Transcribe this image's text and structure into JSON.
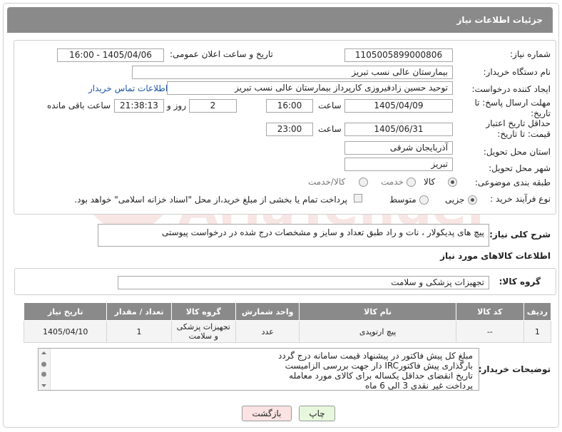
{
  "header": {
    "title": "جزئیات اطلاعات نیاز"
  },
  "form": {
    "need_number_label": "شماره نیاز:",
    "need_number": "1105005899000806",
    "announce_label": "تاریخ و ساعت اعلان عمومی:",
    "announce_value": "1405/04/06 - 16:00",
    "buyer_org_label": "نام دستگاه خریدار:",
    "buyer_org": "بیمارستان عالی نسب تبریز",
    "requester_label": "ایجاد کننده درخواست:",
    "requester": "توحید حسین زادفیروزی کارپرداز بیمارستان عالی نسب تبریز",
    "contact_link": "اطلاعات تماس خریدار",
    "deadline_label": "مهلت ارسال پاسخ: تا تاریخ:",
    "deadline_date": "1405/04/09",
    "time_label": "ساعت",
    "deadline_time": "16:00",
    "days_value": "2",
    "days_label": "روز و",
    "remaining_time": "21:38:13",
    "remaining_label": "ساعت باقی مانده",
    "validity_label": "حداقل تاریخ اعتبار قیمت: تا تاریخ:",
    "validity_date": "1405/06/31",
    "validity_time": "23:00",
    "province_label": "استان محل تحویل:",
    "province": "آذربایجان شرقی",
    "city_label": "شهر محل تحویل:",
    "city": "تبریز",
    "category_label": "طبقه بندی موضوعی:",
    "category_options": [
      "کالا",
      "خدمت",
      "کالا/خدمت"
    ],
    "process_label": "نوع فرآیند خرید :",
    "process_options": [
      "جزیی",
      "متوسط"
    ],
    "payment_note": "پرداخت تمام یا بخشی از مبلغ خرید،از محل \"اسناد خزانه اسلامی\" خواهد بود."
  },
  "description": {
    "label": "شرح کلی نیاز:",
    "text": "پیچ های پدیکولار ، نات و راد طبق تعداد و سایز و مشخصات درج شده در درخواست پیوستی"
  },
  "goods": {
    "section_title": "اطلاعات کالاهای مورد نیاز",
    "group_label": "گروه کالا:",
    "group_value": "تجهیزات پزشکی و سلامت",
    "columns": [
      "ردیف",
      "کد کالا",
      "نام کالا",
      "واحد شمارش",
      "گروه کالا",
      "تعداد / مقدار",
      "تاریخ نیاز"
    ],
    "rows": [
      [
        "1",
        "--",
        "پیچ ارتوپدی",
        "عدد",
        "تجهیزات پزشکی و سلامت",
        "1",
        "1405/04/10"
      ]
    ]
  },
  "notes": {
    "label": "توضیحات خریدار:",
    "lines": [
      "مبلغ کل پیش فاکتور در پیشنهاد قیمت سامانه درج گردد",
      "بارگذاری پیش فاکتورIRC دار جهت بررسی الزامیست",
      "تاریخ انقضای حداقل یکساله برای کالای مورد معامله",
      "پرداخت غیر نقدی 3 الی 6 ماه"
    ]
  },
  "buttons": {
    "print": "چاپ",
    "back": "بازگشت"
  },
  "watermark": {
    "text": "AriaTender.net"
  },
  "colors": {
    "header_bg": "#8a8a8a",
    "link": "#1a56a8",
    "print_bg": "#e6f7dd",
    "back_bg": "#fbe3e3"
  }
}
